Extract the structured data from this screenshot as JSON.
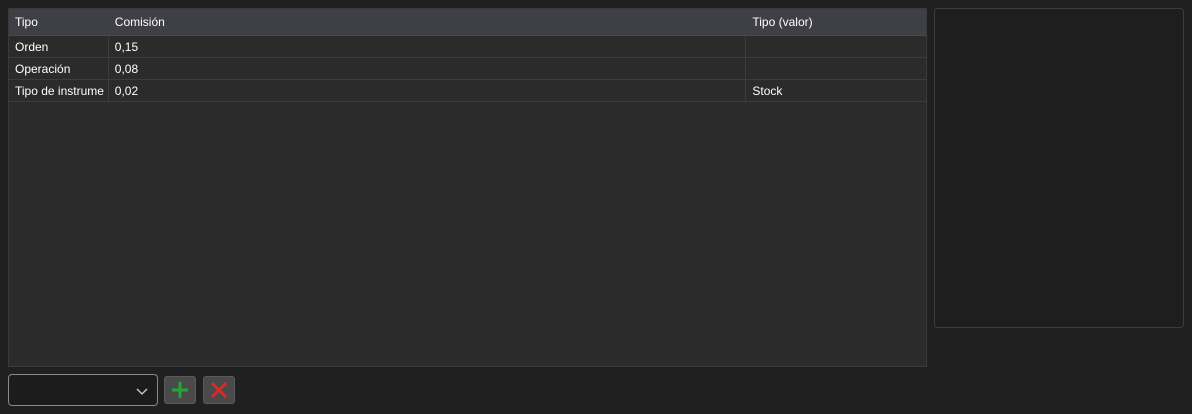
{
  "grid": {
    "columns": [
      "Tipo",
      "Comisión",
      "Tipo (valor)"
    ],
    "rows": [
      {
        "tipo": "Orden",
        "comision": "0,15",
        "tipo_valor": ""
      },
      {
        "tipo": "Operación",
        "comision": "0,08",
        "tipo_valor": ""
      },
      {
        "tipo": "Tipo de instrume",
        "comision": "0,02",
        "tipo_valor": "Stock"
      }
    ]
  },
  "toolbar": {
    "combo_value": "",
    "add_icon": "plus-icon",
    "delete_icon": "x-icon",
    "add_color": "#22a535",
    "delete_color": "#d42b2b"
  }
}
